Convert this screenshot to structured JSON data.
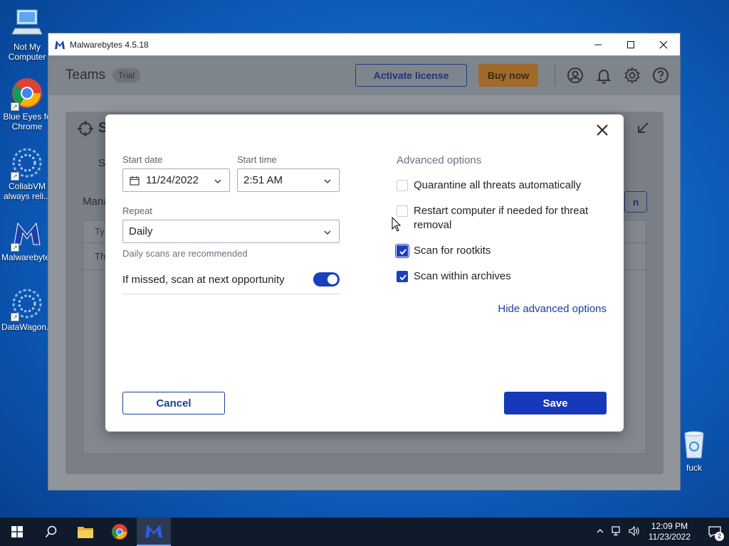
{
  "desktop": {
    "icons": [
      {
        "label": "Not My Computer"
      },
      {
        "label": "Blue Eyes fo Chrome"
      },
      {
        "label": "CollabVM always reli..."
      },
      {
        "label": "Malwarebytes"
      },
      {
        "label": "DataWagon..."
      },
      {
        "label": "fuck"
      }
    ]
  },
  "window": {
    "title": "Malwarebytes 4.5.18",
    "controls": {
      "minimize": "—",
      "maximize": "☐",
      "close": "✕"
    }
  },
  "header": {
    "plan": "Teams",
    "badge": "Trial",
    "activate_label": "Activate license",
    "buy_label": "Buy now",
    "icons": [
      "account-icon",
      "bell-icon",
      "gear-icon",
      "help-icon"
    ]
  },
  "background_panel": {
    "title_initial": "S",
    "tab_initial": "S",
    "section_label": "Mana",
    "col_initial": "Ty",
    "row_initial": "Th",
    "button_fragment": "n"
  },
  "dialog": {
    "start_date_label": "Start date",
    "start_date_value": "11/24/2022",
    "start_time_label": "Start time",
    "start_time_value": "2:51 AM",
    "repeat_label": "Repeat",
    "repeat_value": "Daily",
    "repeat_hint": "Daily scans are recommended",
    "missed_label": "If missed, scan at next opportunity",
    "missed_enabled": true,
    "advanced_title": "Advanced options",
    "options": [
      {
        "label": "Quarantine all threats automatically",
        "checked": false
      },
      {
        "label": "Restart computer if needed for threat removal",
        "checked": false
      },
      {
        "label": "Scan for rootkits",
        "checked": true
      },
      {
        "label": "Scan within archives",
        "checked": true
      }
    ],
    "hide_advanced_label": "Hide advanced options",
    "cancel_label": "Cancel",
    "save_label": "Save"
  },
  "taskbar": {
    "time": "12:09 PM",
    "date": "11/23/2022",
    "notifications": "2"
  },
  "colors": {
    "accent": "#1539b8",
    "buy": "#a06a2b"
  }
}
